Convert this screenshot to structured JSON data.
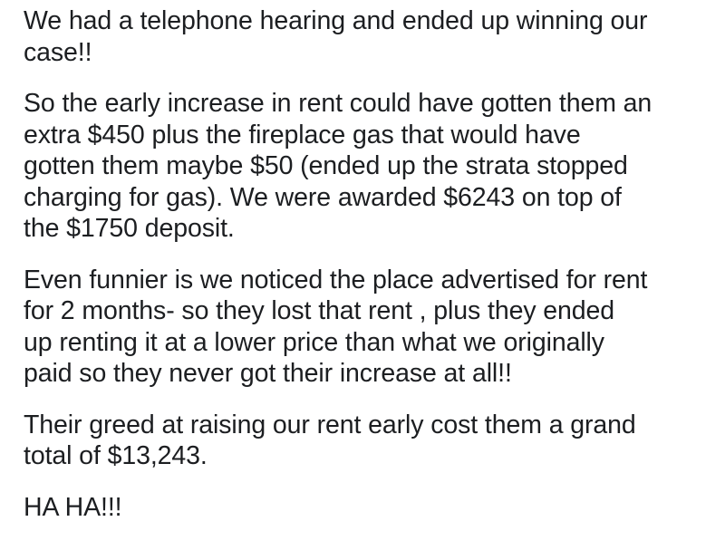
{
  "post": {
    "paragraphs": [
      {
        "lines": [
          "We had a telephone hearing and ended up winning our",
          "case!!"
        ]
      },
      {
        "lines": [
          "So the early increase in rent could have gotten them an",
          "extra $450 plus the fireplace gas that would have",
          "gotten them maybe $50 (ended up the strata stopped",
          "charging for gas). We were awarded $6243 on top of",
          "the $1750 deposit."
        ]
      },
      {
        "lines": [
          "Even funnier is we noticed the place advertised for rent",
          "for 2 months- so they lost that rent , plus they ended",
          "up renting it at a lower price than what we originally",
          "paid so they never got their increase at all!!"
        ]
      },
      {
        "lines": [
          "Their greed at raising our rent early cost them a grand",
          "total of $13,243."
        ]
      },
      {
        "lines": [
          "HA HA!!!"
        ]
      }
    ]
  }
}
